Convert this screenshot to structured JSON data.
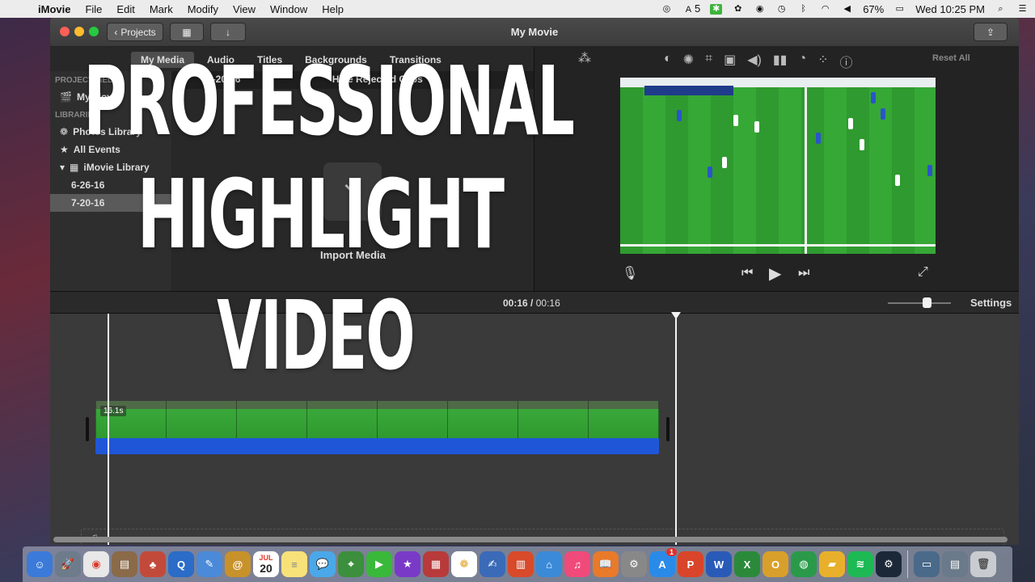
{
  "menubar": {
    "app_name": "iMovie",
    "items": [
      "File",
      "Edit",
      "Mark",
      "Modify",
      "View",
      "Window",
      "Help"
    ],
    "tray_badge_number": "5",
    "battery": "67%",
    "clock": "Wed 10:25 PM"
  },
  "window": {
    "title": "My Movie",
    "projects_button": "Projects"
  },
  "browser": {
    "tabs": [
      "My Media",
      "Audio",
      "Titles",
      "Backgrounds",
      "Transitions"
    ],
    "active_tab": "My Media",
    "sidebar": {
      "project_header": "PROJECT MEDIA",
      "project_item": "My Movie",
      "libraries_header": "LIBRARIES",
      "items": [
        "Photos Library",
        "All Events",
        "iMovie Library",
        "6-26-16",
        "7-20-16"
      ],
      "selected": "7-20-16"
    },
    "media_bar_date": "7-20-16",
    "media_bar_hint": "Hide Rejected Clips",
    "import_label": "Import Media"
  },
  "viewer": {
    "reset_all": "Reset All"
  },
  "timeline": {
    "current_time": "00:16",
    "separator": "/",
    "total_time": "00:16",
    "settings": "Settings",
    "clip_duration": "16.1s",
    "zoom_level": 0.62
  },
  "overlay": {
    "line1": "PROFESSIONAL",
    "line2": "HIGHLIGHT",
    "line3": "VIDEO"
  },
  "colors": {
    "clip_blue": "#1f56d8",
    "pitch_green": "#2f9a2f",
    "home_kit": "#2a55c9",
    "away_kit": "#ffffff"
  },
  "dock": {
    "calendar_month": "JUL",
    "calendar_day": "20",
    "appstore_badge": "1"
  }
}
